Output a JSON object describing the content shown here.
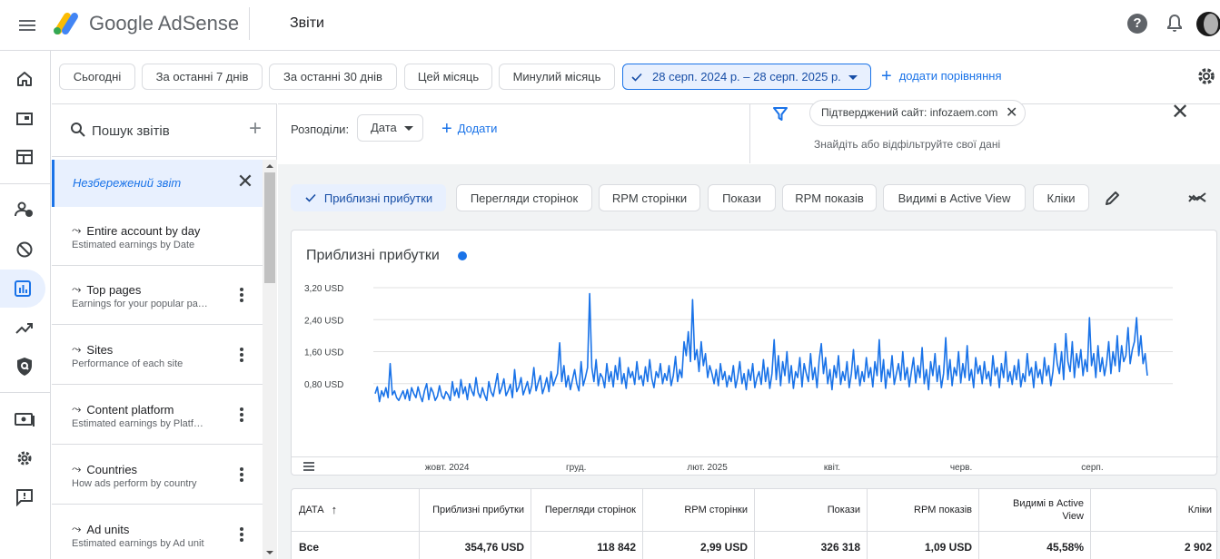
{
  "app": {
    "name": "Google AdSense",
    "page_title": "Звіти",
    "help_symbol": "?"
  },
  "colors": {
    "accent": "#1a73e8",
    "selected_bg": "#e8f0fe"
  },
  "date_filters": [
    {
      "label": "Сьогодні"
    },
    {
      "label": "За останні 7 днів"
    },
    {
      "label": "За останні 30 днів"
    },
    {
      "label": "Цей місяць"
    },
    {
      "label": "Минулий місяць"
    }
  ],
  "date_range": "28 серп. 2024 р. – 28 серп. 2025 р.",
  "add_comparison": "додати порівняння",
  "reports_panel": {
    "search_placeholder": "Пошук звітів",
    "unsaved_label": "Незбережений звіт",
    "items": [
      {
        "title": "Entire account by day",
        "subtitle": "Estimated earnings by Date"
      },
      {
        "title": "Top pages",
        "subtitle": "Earnings for your popular pa…"
      },
      {
        "title": "Sites",
        "subtitle": "Performance of each site"
      },
      {
        "title": "Content platform",
        "subtitle": "Estimated earnings by Platf…"
      },
      {
        "title": "Countries",
        "subtitle": "How ads perform by country"
      },
      {
        "title": "Ad units",
        "subtitle": "Estimated earnings by Ad unit"
      }
    ]
  },
  "breakdown": {
    "label": "Розподіли:",
    "dimension": "Дата",
    "add_label": "Додати"
  },
  "filter": {
    "chip": "Підтверджений сайт: infozaem.com",
    "placeholder": "Знайдіть або відфільтруйте свої дані"
  },
  "metrics": [
    {
      "label": "Приблизні прибутки",
      "selected": true
    },
    {
      "label": "Перегляди сторінок",
      "selected": false
    },
    {
      "label": "RPM сторінки",
      "selected": false
    },
    {
      "label": "Покази",
      "selected": false
    },
    {
      "label": "RPM показів",
      "selected": false
    },
    {
      "label": "Видимі в Active View",
      "selected": false
    },
    {
      "label": "Кліки",
      "selected": false
    }
  ],
  "chart_data": {
    "type": "line",
    "title": "Приблизні прибутки",
    "series_color": "#1a73e8",
    "y_ticks": [
      "3,20 USD",
      "2,40 USD",
      "1,60 USD",
      "0,80 USD"
    ],
    "y_tick_values": [
      3.2,
      2.4,
      1.6,
      0.8
    ],
    "ylim": [
      0,
      3.2
    ],
    "x_ticks": [
      "жовт. 2024",
      "груд.",
      "лют. 2025",
      "квіт.",
      "черв.",
      "серп."
    ],
    "x_tick_days": [
      34,
      95,
      157,
      216,
      277,
      339
    ],
    "x_range_days": [
      0,
      365
    ],
    "grid": true,
    "values": [
      0.55,
      0.72,
      0.35,
      0.62,
      0.48,
      0.7,
      0.45,
      1.3,
      0.52,
      0.62,
      0.45,
      0.38,
      0.5,
      0.62,
      0.42,
      0.65,
      0.38,
      0.7,
      0.55,
      0.45,
      0.72,
      0.5,
      0.35,
      0.62,
      0.8,
      0.4,
      0.7,
      0.58,
      0.38,
      0.48,
      0.75,
      0.5,
      0.42,
      0.6,
      0.52,
      0.38,
      0.85,
      0.5,
      0.68,
      0.45,
      0.9,
      0.55,
      0.72,
      0.4,
      0.8,
      0.62,
      0.5,
      0.95,
      0.58,
      0.45,
      0.7,
      0.52,
      0.38,
      0.85,
      0.6,
      0.48,
      0.75,
      1.05,
      0.55,
      0.7,
      0.92,
      0.5,
      0.62,
      0.78,
      0.45,
      1.15,
      0.6,
      0.72,
      0.95,
      0.52,
      0.68,
      0.85,
      0.55,
      0.75,
      1.2,
      0.62,
      0.82,
      1.0,
      0.55,
      0.72,
      0.95,
      0.6,
      1.1,
      0.75,
      0.9,
      1.05,
      1.82,
      0.85,
      1.25,
      0.72,
      1.0,
      0.65,
      0.9,
      1.15,
      0.8,
      0.62,
      1.35,
      0.75,
      0.95,
      1.2,
      3.05,
      1.2,
      0.85,
      1.4,
      0.75,
      1.05,
      0.95,
      0.7,
      1.3,
      0.85,
      1.1,
      0.72,
      1.25,
      0.9,
      1.45,
      0.8,
      1.05,
      0.68,
      1.2,
      0.95,
      1.1,
      0.78,
      1.35,
      0.9,
      1.0,
      0.75,
      1.22,
      0.85,
      1.4,
      0.92,
      0.7,
      1.1,
      0.95,
      1.3,
      0.8,
      1.05,
      0.88,
      1.25,
      0.75,
      1.0,
      1.48,
      0.85,
      1.15,
      0.95,
      1.85,
      1.5,
      2.1,
      1.35,
      2.9,
      1.4,
      1.65,
      1.1,
      1.85,
      1.25,
      1.55,
      0.95,
      1.25,
      1.05,
      0.8,
      1.15,
      0.75,
      1.3,
      0.9,
      1.1,
      0.72,
      1.0,
      0.85,
      1.25,
      0.7,
      0.95,
      1.35,
      0.8,
      1.05,
      0.65,
      1.15,
      0.88,
      1.3,
      0.7,
      0.95,
      1.1,
      0.78,
      1.4,
      0.85,
      1.2,
      0.68,
      1.05,
      1.9,
      0.9,
      1.5,
      0.75,
      1.35,
      1.0,
      1.6,
      0.82,
      1.25,
      0.68,
      1.1,
      0.95,
      1.45,
      0.72,
      1.3,
      1.05,
      0.85,
      1.55,
      0.9,
      1.2,
      0.7,
      1.4,
      1.8,
      1.05,
      1.45,
      0.8,
      1.15,
      0.65,
      1.25,
      0.95,
      1.5,
      0.78,
      1.1,
      0.88,
      1.35,
      0.7,
      1.05,
      1.65,
      0.92,
      1.25,
      0.75,
      1.1,
      0.85,
      1.45,
      0.95,
      1.2,
      0.72,
      1.35,
      1.0,
      1.9,
      0.85,
      1.4,
      0.68,
      1.15,
      0.95,
      1.5,
      0.78,
      1.05,
      1.3,
      0.88,
      1.6,
      0.9,
      1.2,
      0.72,
      1.1,
      1.45,
      0.82,
      1.25,
      0.95,
      1.7,
      0.8,
      1.15,
      0.65,
      1.35,
      1.0,
      1.55,
      0.85,
      1.25,
      0.7,
      1.05,
      1.95,
      0.9,
      1.4,
      0.75,
      1.2,
      1.0,
      1.6,
      0.82,
      1.3,
      0.95,
      1.75,
      0.88,
      1.15,
      0.7,
      1.45,
      1.05,
      1.25,
      0.8,
      1.35,
      0.92,
      1.1,
      0.75,
      1.5,
      1.0,
      1.2,
      0.7,
      1.3,
      0.95,
      1.6,
      0.85,
      1.1,
      0.78,
      1.25,
      0.9,
      1.4,
      0.72,
      1.05,
      0.85,
      1.55,
      1.0,
      1.2,
      0.7,
      1.35,
      0.95,
      1.15,
      0.8,
      1.45,
      1.0,
      1.25,
      0.75,
      1.1,
      1.8,
      1.3,
      1.05,
      1.6,
      0.9,
      2.05,
      1.35,
      1.1,
      1.85,
      0.95,
      1.55,
      1.2,
      1.65,
      1.0,
      1.4,
      1.1,
      2.45,
      1.25,
      1.55,
      0.95,
      1.75,
      1.1,
      1.45,
      1.0,
      1.3,
      1.85,
      1.05,
      1.6,
      1.25,
      2.0,
      1.1,
      1.75,
      1.35,
      1.5,
      2.2,
      1.3,
      1.65,
      1.85,
      2.45,
      1.5,
      2.0,
      1.3,
      1.55,
      1.0
    ]
  },
  "table": {
    "headers": [
      "ДАТА",
      "Приблизні прибутки",
      "Перегляди сторінок",
      "RPM сторінки",
      "Покази",
      "RPM показів",
      "Видимі в Active View",
      "Кліки"
    ],
    "sort_arrow": "↑",
    "total_row": [
      "Все",
      "354,76 USD",
      "118 842",
      "2,99 USD",
      "326 318",
      "1,09 USD",
      "45,58%",
      "2 902"
    ]
  }
}
